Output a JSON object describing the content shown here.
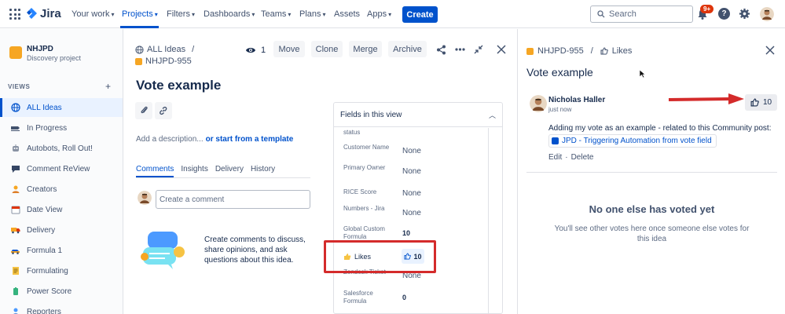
{
  "nav": {
    "brand": "Jira",
    "items": [
      {
        "label": "Your work"
      },
      {
        "label": "Projects"
      },
      {
        "label": "Filters"
      },
      {
        "label": "Dashboards"
      },
      {
        "label": "Teams"
      },
      {
        "label": "Plans"
      },
      {
        "label": "Assets"
      },
      {
        "label": "Apps"
      }
    ],
    "create_label": "Create",
    "search_placeholder": "Search",
    "notif_badge": "9+",
    "accent": "#0052cc"
  },
  "sidebar": {
    "project_name": "NHJPD",
    "project_type": "Discovery project",
    "views_label": "VIEWS",
    "items": [
      {
        "label": "ALL Ideas",
        "icon": "globe-icon"
      },
      {
        "label": "In Progress",
        "icon": "soon-icon"
      },
      {
        "label": "Autobots, Roll Out!",
        "icon": "robot-icon"
      },
      {
        "label": "Comment ReView",
        "icon": "comment-icon"
      },
      {
        "label": "Creators",
        "icon": "person-icon"
      },
      {
        "label": "Date View",
        "icon": "calendar-icon"
      },
      {
        "label": "Delivery",
        "icon": "truck-icon"
      },
      {
        "label": "Formula 1",
        "icon": "car-icon"
      },
      {
        "label": "Formulating",
        "icon": "notes-icon"
      },
      {
        "label": "Power Score",
        "icon": "battery-icon"
      },
      {
        "label": "Reporters",
        "icon": "person-icon"
      }
    ]
  },
  "issue": {
    "breadcrumb_view": "ALL Ideas",
    "breadcrumb_sep": "/",
    "key": "NHJPD-955",
    "watchers": "1",
    "buttons": {
      "move": "Move",
      "clone": "Clone",
      "merge": "Merge",
      "archive": "Archive"
    },
    "title": "Vote example",
    "desc_placeholder": "Add a description...",
    "desc_template": "or start from a template",
    "tabs": [
      {
        "label": "Comments"
      },
      {
        "label": "Insights"
      },
      {
        "label": "Delivery"
      },
      {
        "label": "History"
      }
    ],
    "comment_placeholder": "Create a comment",
    "empty_comments": "Create comments to discuss, share opinions, and ask questions about this idea."
  },
  "fields_panel": {
    "title": "Fields in this view",
    "rows": [
      {
        "label": "status",
        "value": ""
      },
      {
        "label": "Customer Name",
        "value": "None"
      },
      {
        "label": "Primary Owner",
        "value": "None"
      },
      {
        "label": "RICE Score",
        "value": "None"
      },
      {
        "label": "Numbers - Jira",
        "value": "None"
      },
      {
        "label": "Global Custom Formula",
        "value": "10"
      },
      {
        "label": "Likes",
        "value": "10"
      },
      {
        "label": "Zendesk Ticket",
        "value": "None"
      },
      {
        "label": "Salesforce Formula",
        "value": "0"
      }
    ]
  },
  "likes_panel": {
    "key": "NHJPD-955",
    "sep": "/",
    "tab": "Likes",
    "title": "Vote example",
    "voter_name": "Nicholas Haller",
    "voter_time": "just now",
    "vote_count": "10",
    "vote_message": "Adding my vote as an example - related to this Community post:",
    "post_link": "JPD - Triggering Automation from vote field",
    "action_edit": "Edit",
    "action_sep": "·",
    "action_delete": "Delete",
    "empty_title": "No one else has voted yet",
    "empty_sub": "You'll see other votes here once someone else votes for this idea"
  },
  "colors": {
    "highlight": "#d42b2b",
    "brand_orange": "#f6a623"
  }
}
